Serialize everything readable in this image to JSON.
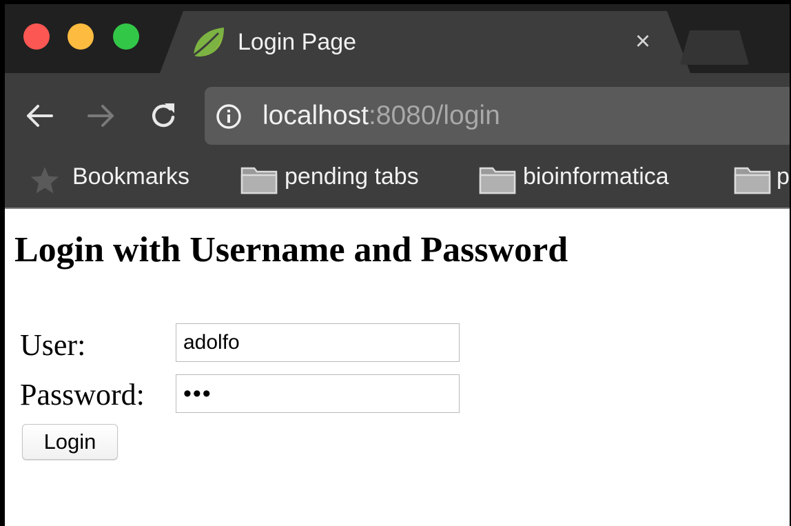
{
  "browser": {
    "tab": {
      "title": "Login Page",
      "favicon": "spring-leaf-icon"
    },
    "address": {
      "host": "localhost",
      "rest": ":8080/login"
    },
    "bookmarks": [
      {
        "label": "Bookmarks",
        "icon": "star-icon"
      },
      {
        "label": "pending tabs",
        "icon": "folder-icon"
      },
      {
        "label": "bioinformatica",
        "icon": "folder-icon"
      },
      {
        "label": "p",
        "icon": "folder-icon"
      }
    ],
    "colors": {
      "traffic_red": "#fc5753",
      "traffic_yellow": "#fdbc40",
      "traffic_green": "#33c748",
      "toolbar": "#3d3d3d"
    }
  },
  "page": {
    "heading": "Login with Username and Password",
    "user_label": "User:",
    "user_value": "adolfo",
    "password_label": "Password:",
    "password_masked": "•••",
    "login_button": "Login"
  }
}
